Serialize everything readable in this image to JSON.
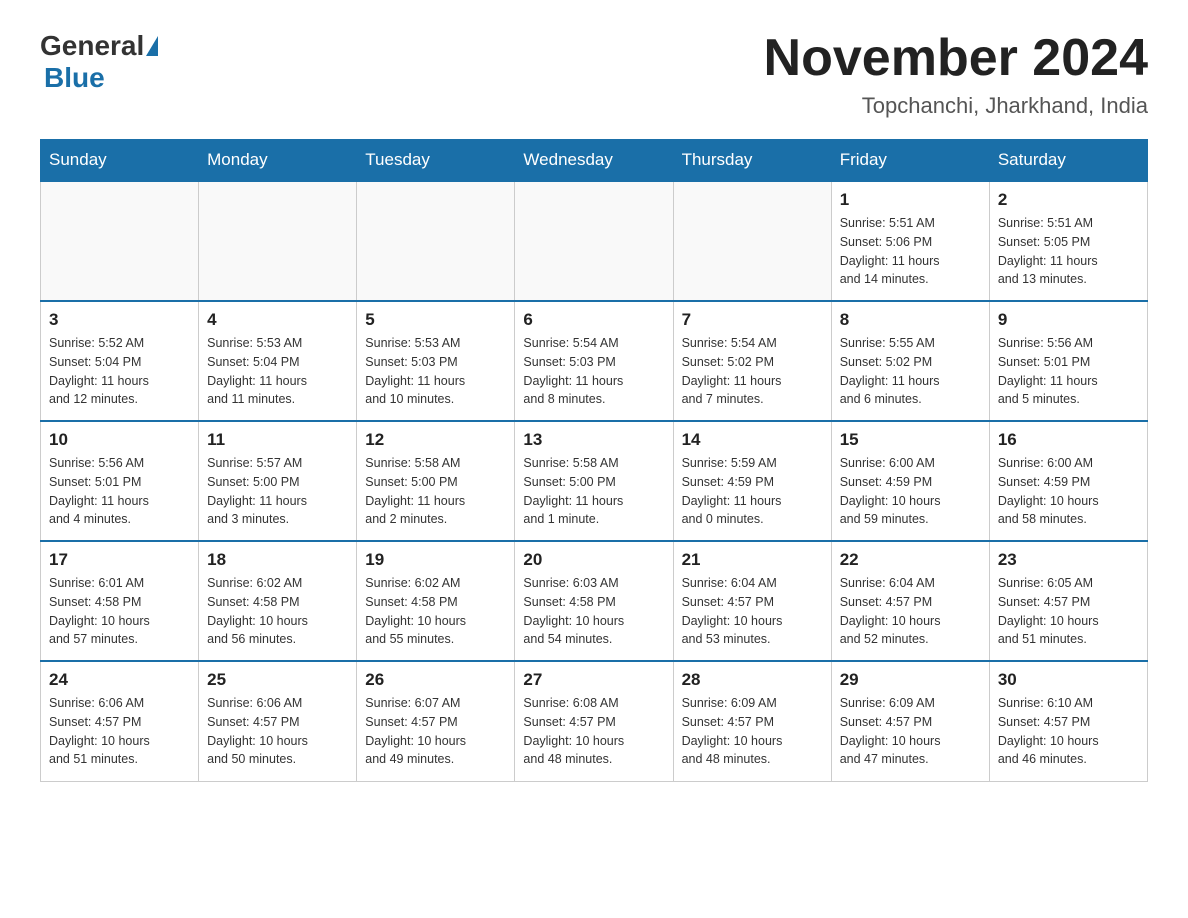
{
  "header": {
    "logo_general": "General",
    "logo_blue": "Blue",
    "month_title": "November 2024",
    "location": "Topchanchi, Jharkhand, India"
  },
  "weekdays": [
    "Sunday",
    "Monday",
    "Tuesday",
    "Wednesday",
    "Thursday",
    "Friday",
    "Saturday"
  ],
  "weeks": [
    [
      {
        "day": "",
        "info": ""
      },
      {
        "day": "",
        "info": ""
      },
      {
        "day": "",
        "info": ""
      },
      {
        "day": "",
        "info": ""
      },
      {
        "day": "",
        "info": ""
      },
      {
        "day": "1",
        "info": "Sunrise: 5:51 AM\nSunset: 5:06 PM\nDaylight: 11 hours\nand 14 minutes."
      },
      {
        "day": "2",
        "info": "Sunrise: 5:51 AM\nSunset: 5:05 PM\nDaylight: 11 hours\nand 13 minutes."
      }
    ],
    [
      {
        "day": "3",
        "info": "Sunrise: 5:52 AM\nSunset: 5:04 PM\nDaylight: 11 hours\nand 12 minutes."
      },
      {
        "day": "4",
        "info": "Sunrise: 5:53 AM\nSunset: 5:04 PM\nDaylight: 11 hours\nand 11 minutes."
      },
      {
        "day": "5",
        "info": "Sunrise: 5:53 AM\nSunset: 5:03 PM\nDaylight: 11 hours\nand 10 minutes."
      },
      {
        "day": "6",
        "info": "Sunrise: 5:54 AM\nSunset: 5:03 PM\nDaylight: 11 hours\nand 8 minutes."
      },
      {
        "day": "7",
        "info": "Sunrise: 5:54 AM\nSunset: 5:02 PM\nDaylight: 11 hours\nand 7 minutes."
      },
      {
        "day": "8",
        "info": "Sunrise: 5:55 AM\nSunset: 5:02 PM\nDaylight: 11 hours\nand 6 minutes."
      },
      {
        "day": "9",
        "info": "Sunrise: 5:56 AM\nSunset: 5:01 PM\nDaylight: 11 hours\nand 5 minutes."
      }
    ],
    [
      {
        "day": "10",
        "info": "Sunrise: 5:56 AM\nSunset: 5:01 PM\nDaylight: 11 hours\nand 4 minutes."
      },
      {
        "day": "11",
        "info": "Sunrise: 5:57 AM\nSunset: 5:00 PM\nDaylight: 11 hours\nand 3 minutes."
      },
      {
        "day": "12",
        "info": "Sunrise: 5:58 AM\nSunset: 5:00 PM\nDaylight: 11 hours\nand 2 minutes."
      },
      {
        "day": "13",
        "info": "Sunrise: 5:58 AM\nSunset: 5:00 PM\nDaylight: 11 hours\nand 1 minute."
      },
      {
        "day": "14",
        "info": "Sunrise: 5:59 AM\nSunset: 4:59 PM\nDaylight: 11 hours\nand 0 minutes."
      },
      {
        "day": "15",
        "info": "Sunrise: 6:00 AM\nSunset: 4:59 PM\nDaylight: 10 hours\nand 59 minutes."
      },
      {
        "day": "16",
        "info": "Sunrise: 6:00 AM\nSunset: 4:59 PM\nDaylight: 10 hours\nand 58 minutes."
      }
    ],
    [
      {
        "day": "17",
        "info": "Sunrise: 6:01 AM\nSunset: 4:58 PM\nDaylight: 10 hours\nand 57 minutes."
      },
      {
        "day": "18",
        "info": "Sunrise: 6:02 AM\nSunset: 4:58 PM\nDaylight: 10 hours\nand 56 minutes."
      },
      {
        "day": "19",
        "info": "Sunrise: 6:02 AM\nSunset: 4:58 PM\nDaylight: 10 hours\nand 55 minutes."
      },
      {
        "day": "20",
        "info": "Sunrise: 6:03 AM\nSunset: 4:58 PM\nDaylight: 10 hours\nand 54 minutes."
      },
      {
        "day": "21",
        "info": "Sunrise: 6:04 AM\nSunset: 4:57 PM\nDaylight: 10 hours\nand 53 minutes."
      },
      {
        "day": "22",
        "info": "Sunrise: 6:04 AM\nSunset: 4:57 PM\nDaylight: 10 hours\nand 52 minutes."
      },
      {
        "day": "23",
        "info": "Sunrise: 6:05 AM\nSunset: 4:57 PM\nDaylight: 10 hours\nand 51 minutes."
      }
    ],
    [
      {
        "day": "24",
        "info": "Sunrise: 6:06 AM\nSunset: 4:57 PM\nDaylight: 10 hours\nand 51 minutes."
      },
      {
        "day": "25",
        "info": "Sunrise: 6:06 AM\nSunset: 4:57 PM\nDaylight: 10 hours\nand 50 minutes."
      },
      {
        "day": "26",
        "info": "Sunrise: 6:07 AM\nSunset: 4:57 PM\nDaylight: 10 hours\nand 49 minutes."
      },
      {
        "day": "27",
        "info": "Sunrise: 6:08 AM\nSunset: 4:57 PM\nDaylight: 10 hours\nand 48 minutes."
      },
      {
        "day": "28",
        "info": "Sunrise: 6:09 AM\nSunset: 4:57 PM\nDaylight: 10 hours\nand 48 minutes."
      },
      {
        "day": "29",
        "info": "Sunrise: 6:09 AM\nSunset: 4:57 PM\nDaylight: 10 hours\nand 47 minutes."
      },
      {
        "day": "30",
        "info": "Sunrise: 6:10 AM\nSunset: 4:57 PM\nDaylight: 10 hours\nand 46 minutes."
      }
    ]
  ]
}
